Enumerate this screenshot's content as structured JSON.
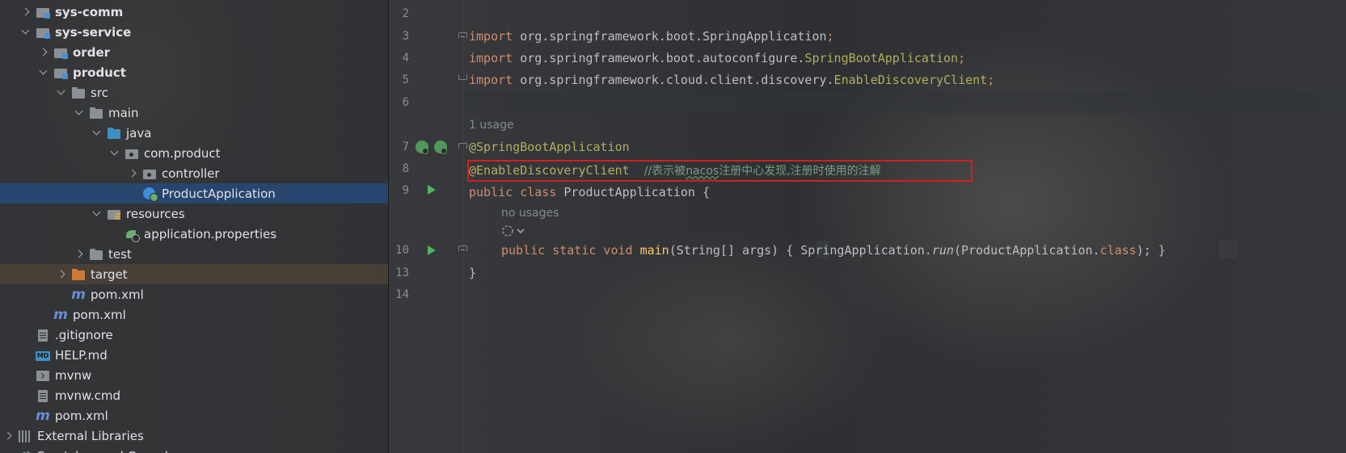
{
  "project_tree": {
    "items": [
      {
        "label": "sys-comm",
        "chevron": "right",
        "icon": "module-icon",
        "depth": 1,
        "bold": true
      },
      {
        "label": "sys-service",
        "chevron": "down",
        "icon": "module-icon",
        "depth": 1,
        "bold": true
      },
      {
        "label": "order",
        "chevron": "right",
        "icon": "module-icon",
        "depth": 2,
        "bold": true
      },
      {
        "label": "product",
        "chevron": "down",
        "icon": "module-icon",
        "depth": 2,
        "bold": true
      },
      {
        "label": "src",
        "chevron": "down",
        "icon": "folder-icon",
        "depth": 3
      },
      {
        "label": "main",
        "chevron": "down",
        "icon": "folder-icon",
        "depth": 4
      },
      {
        "label": "java",
        "chevron": "down",
        "icon": "source-folder-icon",
        "depth": 5
      },
      {
        "label": "com.product",
        "chevron": "down",
        "icon": "package-icon",
        "depth": 6
      },
      {
        "label": "controller",
        "chevron": "right",
        "icon": "package-icon",
        "depth": 7
      },
      {
        "label": "ProductApplication",
        "chevron": "none",
        "icon": "spring-class-icon",
        "depth": 7,
        "selected": true
      },
      {
        "label": "resources",
        "chevron": "down",
        "icon": "resources-folder-icon",
        "depth": 5
      },
      {
        "label": "application.properties",
        "chevron": "none",
        "icon": "spring-properties-icon",
        "depth": 6
      },
      {
        "label": "test",
        "chevron": "right",
        "icon": "folder-icon",
        "depth": 4
      },
      {
        "label": "target",
        "chevron": "right",
        "icon": "target-folder-icon",
        "depth": 3,
        "excluded": true
      },
      {
        "label": "pom.xml",
        "chevron": "none",
        "icon": "maven-icon",
        "depth": 3
      },
      {
        "label": "pom.xml",
        "chevron": "none",
        "icon": "maven-icon",
        "depth": 2
      },
      {
        "label": ".gitignore",
        "chevron": "none",
        "icon": "gitignore-icon",
        "depth": 1
      },
      {
        "label": "HELP.md",
        "chevron": "none",
        "icon": "markdown-icon",
        "depth": 1
      },
      {
        "label": "mvnw",
        "chevron": "none",
        "icon": "terminal-icon",
        "depth": 1
      },
      {
        "label": "mvnw.cmd",
        "chevron": "none",
        "icon": "file-icon",
        "depth": 1
      },
      {
        "label": "pom.xml",
        "chevron": "none",
        "icon": "maven-icon",
        "depth": 1
      },
      {
        "label": "External Libraries",
        "chevron": "right",
        "icon": "libraries-icon",
        "depth": 0
      },
      {
        "label": "Scratches and Consoles",
        "chevron": "none",
        "icon": "scratches-icon",
        "depth": 0
      }
    ]
  },
  "editor": {
    "line_numbers": [
      "2",
      "3",
      "4",
      "5",
      "6",
      "7",
      "8",
      "9",
      "10",
      "13",
      "14"
    ],
    "usage_hint_1": "1 usage",
    "usage_hint_2": "no usages",
    "code": {
      "l3_kw": "import",
      "l3_pkg": " org.springframework.boot.",
      "l3_cls": "SpringApplication",
      "l3_semi": ";",
      "l4_kw": "import",
      "l4_pkg": " org.springframework.boot.autoconfigure.",
      "l4_cls": "SpringBootApplication",
      "l4_semi": ";",
      "l5_kw": "import",
      "l5_pkg": " org.springframework.cloud.client.discovery.",
      "l5_cls": "EnableDiscoveryClient",
      "l5_semi": ";",
      "l7_ann": "@SpringBootApplication",
      "l8_ann": "@EnableDiscoveryClient",
      "l8_comment_a": "//表示被",
      "l8_comment_b": "nacos",
      "l8_comment_c": "注册中心发现,注册时使用的注解",
      "l9_kw": "public class",
      "l9_name": " ProductApplication {",
      "l10_kw": "public static void",
      "l10_fn": " main",
      "l10_args": "(String[] args) ",
      "l10_open": "{",
      "l10_body_a": " SpringApplication.",
      "l10_body_run": "run",
      "l10_body_b": "(ProductApplication.",
      "l10_body_class": "class",
      "l10_body_c": ");",
      "l10_close": " }",
      "l13": "}"
    }
  },
  "colors": {
    "keyword": "#cf8e6d",
    "annotation": "#b3ae60",
    "comment": "#7a9e7e",
    "method": "#ffc66d",
    "highlight_box": "#d21f1f",
    "selection": "#264c80"
  }
}
